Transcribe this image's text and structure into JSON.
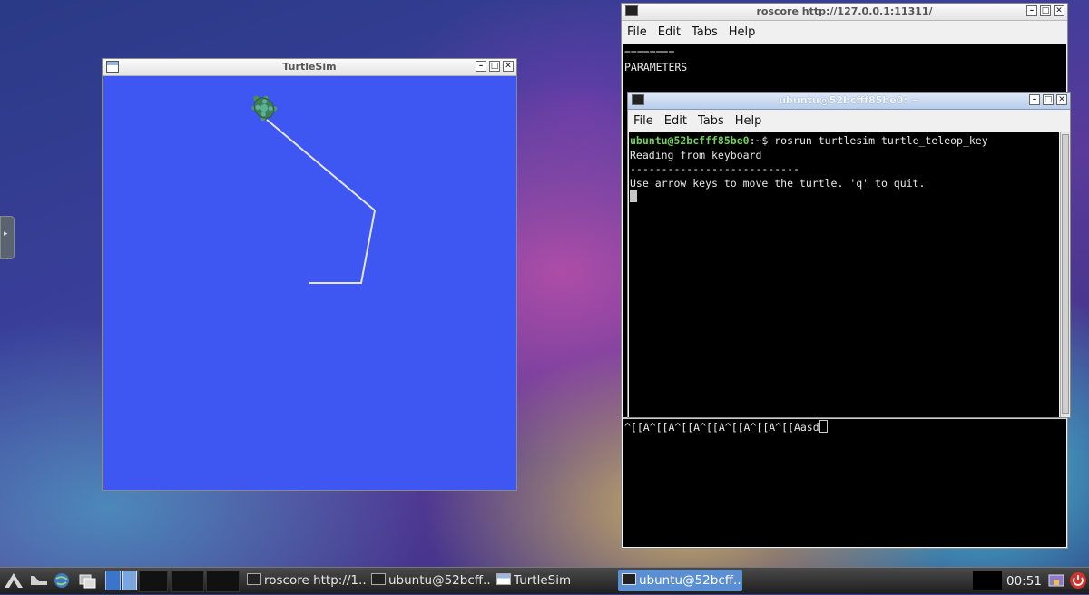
{
  "turtlesim": {
    "title": "TurtleSim",
    "canvas_color": "#3f57f2",
    "path_color": "#e6e6f0"
  },
  "roscore": {
    "title": "roscore http://127.0.0.1:11311/",
    "menu": [
      "File",
      "Edit",
      "Tabs",
      "Help"
    ],
    "lines": [
      "========",
      "",
      "PARAMETERS"
    ],
    "bottom_line": "^[[A^[[A^[[A^[[A^[[A^[[A^[[Aasd"
  },
  "ubuntu_terminal": {
    "title": "ubuntu@52bcfff85be0: ~",
    "menu": [
      "File",
      "Edit",
      "Tabs",
      "Help"
    ],
    "prompt_user": "ubuntu@52bcfff85be0",
    "prompt_rest": ":~$ rosrun turtlesim turtle_teleop_key",
    "line1": "Reading from keyboard",
    "line2": "---------------------------",
    "line3": "Use arrow keys to move the turtle. 'q' to quit."
  },
  "window_buttons": {
    "minimize": "–",
    "maximize": "□",
    "close": "✕"
  },
  "side_handle": {
    "icon": "▸"
  },
  "taskbar": {
    "tasks": [
      {
        "label": "roscore http://1..."
      },
      {
        "label": "ubuntu@52bcff..."
      },
      {
        "label": "TurtleSim"
      },
      {
        "label": "ubuntu@52bcff..."
      }
    ],
    "clock": "00:51",
    "accent": "#5b8fd4"
  }
}
